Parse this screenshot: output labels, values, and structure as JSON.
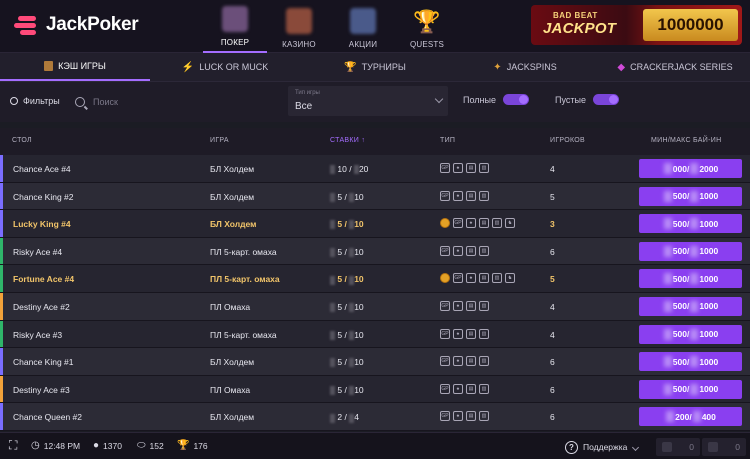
{
  "brand": {
    "name": "JackPoker"
  },
  "topnav": [
    {
      "label": "ПОКЕР",
      "active": true,
      "thumb": "#6b4f7a"
    },
    {
      "label": "КАЗИНО",
      "active": false,
      "thumb": "#8a4a3a"
    },
    {
      "label": "АКЦИИ",
      "active": false,
      "thumb": "#4a5a8a"
    },
    {
      "label": "QUESTS",
      "active": false,
      "icon": "trophy-icon"
    }
  ],
  "jackpot": {
    "line1": "BAD BEAT",
    "line2": "JACKPOT",
    "value": "1000000"
  },
  "subtabs": [
    {
      "label": "КЭШ ИГРЫ",
      "icon": "cards-icon",
      "active": true
    },
    {
      "label": "LUCK OR MUCK",
      "icon": "slash-icon",
      "active": false
    },
    {
      "label": "ТУРНИРЫ",
      "icon": "trophy-icon",
      "active": false
    },
    {
      "label": "JACKSPINS",
      "icon": "spin-icon",
      "active": false
    },
    {
      "label": "CRACKERJACK SERIES",
      "icon": "gem-icon",
      "active": false
    }
  ],
  "filters": {
    "filters_label": "Фильтры",
    "search_placeholder": "Поиск",
    "type_small": "Тип игры",
    "type_value": "Все",
    "full_label": "Полные",
    "empty_label": "Пустые"
  },
  "columns": {
    "table": "СТОЛ",
    "game": "ИГРА",
    "stakes": "СТАВКИ ↑",
    "type": "ТИП",
    "players": "ИГРОКОВ",
    "buyin": "МИН/МАКС БАЙ-ИН"
  },
  "rows": [
    {
      "table": "Chance Ace #4",
      "game": "БЛ Холдем",
      "stake_a": "10",
      "stake_b": "20",
      "players": "4",
      "buy_a": "000",
      "buy_b": "2000",
      "highlight": false,
      "color": "#7a6dff",
      "coin": false,
      "icons": 3
    },
    {
      "table": "Chance King #2",
      "game": "БЛ Холдем",
      "stake_a": "5",
      "stake_b": "10",
      "players": "5",
      "buy_a": "500",
      "buy_b": "1000",
      "highlight": false,
      "color": "#7a6dff",
      "coin": false,
      "icons": 3
    },
    {
      "table": "Lucky King #4",
      "game": "БЛ Холдем",
      "stake_a": "5",
      "stake_b": "10",
      "players": "3",
      "buy_a": "500",
      "buy_b": "1000",
      "highlight": true,
      "color": "#7a6dff",
      "coin": true,
      "icons": 4
    },
    {
      "table": "Risky Ace #4",
      "game": "ПЛ 5-карт. омаха",
      "stake_a": "5",
      "stake_b": "10",
      "players": "6",
      "buy_a": "500",
      "buy_b": "1000",
      "highlight": false,
      "color": "#2fb56a",
      "coin": false,
      "icons": 3
    },
    {
      "table": "Fortune Ace #4",
      "game": "ПЛ 5-карт. омаха",
      "stake_a": "5",
      "stake_b": "10",
      "players": "5",
      "buy_a": "500",
      "buy_b": "1000",
      "highlight": true,
      "color": "#2fb56a",
      "coin": true,
      "icons": 4
    },
    {
      "table": "Destiny Ace #2",
      "game": "ПЛ Омаха",
      "stake_a": "5",
      "stake_b": "10",
      "players": "4",
      "buy_a": "500",
      "buy_b": "1000",
      "highlight": false,
      "color": "#f2a23a",
      "coin": false,
      "icons": 3
    },
    {
      "table": "Risky Ace #3",
      "game": "ПЛ 5-карт. омаха",
      "stake_a": "5",
      "stake_b": "10",
      "players": "4",
      "buy_a": "500",
      "buy_b": "1000",
      "highlight": false,
      "color": "#2fb56a",
      "coin": false,
      "icons": 3
    },
    {
      "table": "Chance King #1",
      "game": "БЛ Холдем",
      "stake_a": "5",
      "stake_b": "10",
      "players": "6",
      "buy_a": "500",
      "buy_b": "1000",
      "highlight": false,
      "color": "#7a6dff",
      "coin": false,
      "icons": 3
    },
    {
      "table": "Destiny Ace #3",
      "game": "ПЛ Омаха",
      "stake_a": "5",
      "stake_b": "10",
      "players": "6",
      "buy_a": "500",
      "buy_b": "1000",
      "highlight": false,
      "color": "#f2a23a",
      "coin": false,
      "icons": 3
    },
    {
      "table": "Chance Queen #2",
      "game": "БЛ Холдем",
      "stake_a": "2",
      "stake_b": "4",
      "players": "6",
      "buy_a": "200",
      "buy_b": "400",
      "highlight": false,
      "color": "#7a6dff",
      "coin": false,
      "icons": 3
    }
  ],
  "footer": {
    "time": "12:48 PM",
    "players": "1370",
    "tables": "152",
    "tournaments": "176",
    "support": "Поддержка",
    "chips1": "0",
    "chips2": "0"
  },
  "colors": {
    "accent": "#8a3ff0",
    "highlight_text": "#f2c56a"
  }
}
